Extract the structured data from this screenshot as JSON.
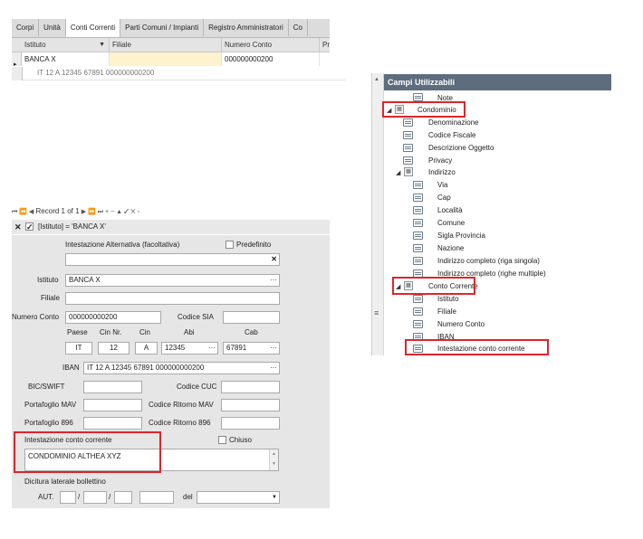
{
  "tabs": [
    "Corpi",
    "Unità",
    "Conti Correnti",
    "Parti Comuni / Impianti",
    "Registro Amministratori",
    "Co"
  ],
  "active_tab": "Conti Correnti",
  "grid": {
    "columns": [
      "Istituto",
      "Filiale",
      "Numero Conto",
      "Pre"
    ],
    "row": {
      "istituto": "BANCA X",
      "filiale": "",
      "numero_conto": "000000000200"
    },
    "detail": "IT 12 A 12345 67891 000000000200"
  },
  "navigator": {
    "icons": "⏮ ⏪ ◀",
    "record_text": "Record 1 of 1",
    "icons_after": "▶ ⏩ ⏭ + − ▲ ✓ ✕ ◦"
  },
  "filter": {
    "text": "[Istituto] = 'BANCA X'"
  },
  "form": {
    "intestazione_alt_label": "Intestazione Alternativa (facoltativa)",
    "predefinito_label": "Predefinito",
    "intestazione_alt_value": "",
    "clear_icon": "✕",
    "istituto_label": "Istituto",
    "istituto_value": "BANCA X",
    "filiale_label": "Filiale",
    "filiale_value": "",
    "numero_conto_label": "Numero Conto",
    "numero_conto_value": "000000000200",
    "codice_sia_label": "Codice SIA",
    "codice_sia_value": "",
    "paese_label": "Paese",
    "cin_nr_label": "Cin Nr.",
    "cin_label": "Cin",
    "abi_label": "Abi",
    "cab_label": "Cab",
    "paese_value": "IT",
    "cin_nr_value": "12",
    "cin_value": "A",
    "abi_value": "12345",
    "cab_value": "67891",
    "iban_label": "IBAN",
    "iban_value": "IT 12 A 12345 67891 000000000200",
    "bic_label": "BIC/SWIFT",
    "codice_cuc_label": "Codice CUC",
    "portafoglio_mav_label": "Portafoglio MAV",
    "codice_ritorno_mav_label": "Codice Ritorno MAV",
    "portafoglio_896_label": "Portafoglio 896",
    "codice_ritorno_896_label": "Codice Ritorno 896",
    "intestazione_cc_label": "Intestazione conto corrente",
    "chiuso_label": "Chiuso",
    "intestazione_cc_value": "CONDOMINIO ALTHEA XYZ",
    "dicitura_label": "Dicitura laterale bollettino",
    "aut_label": "AUT.",
    "slash": "/",
    "del_label": "del",
    "dots": "···"
  },
  "tree": {
    "header": "Campi Utilizzabili",
    "items": {
      "note": "Note",
      "condominio": "Condominio",
      "denominazione": "Denominazione",
      "codice_fiscale": "Codice Fiscale",
      "descrizione_oggetto": "Descrizione Oggetto",
      "privacy": "Privacy",
      "indirizzo": "Indirizzo",
      "via": "Via",
      "cap": "Cap",
      "localita": "Località",
      "comune": "Comune",
      "sigla_provincia": "Sigla Provincia",
      "nazione": "Nazione",
      "indirizzo_singola": "Indirizzo completo (riga singola)",
      "indirizzo_multiple": "Indirizzo completo (righe multiple)",
      "conto_corrente": "Conto Corrente",
      "istituto": "Istituto",
      "filiale": "Filiale",
      "numero_conto": "Numero Conto",
      "iban": "IBAN",
      "intestazione_cc": "Intestazione conto corrente"
    },
    "side_glyph": "≡"
  },
  "colors": {
    "highlight": "#e0242b",
    "tree_header": "#5d6d7e"
  }
}
